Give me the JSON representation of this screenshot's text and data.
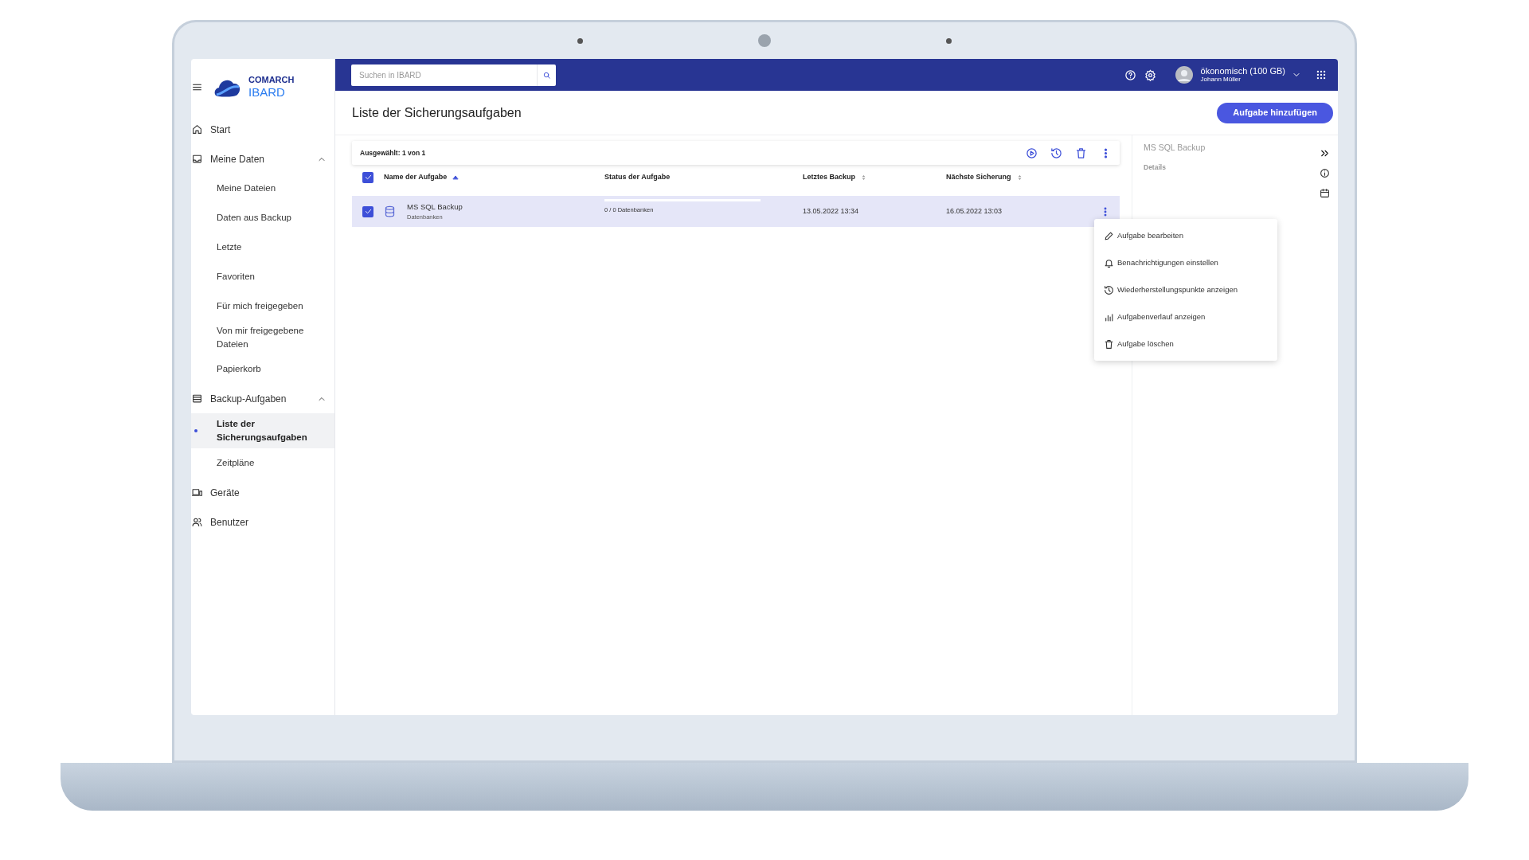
{
  "sidebar": {
    "logo": {
      "line1": "COMARCH",
      "line2": "IBARD"
    },
    "items": [
      {
        "label": "Start",
        "selected": false
      },
      {
        "label": "Meine Daten",
        "selected": false,
        "expanded": true,
        "children": [
          {
            "label": "Meine Dateien",
            "selected": false
          },
          {
            "label": "Daten aus Backup",
            "selected": false
          },
          {
            "label": "Letzte",
            "selected": false
          },
          {
            "label": "Favoriten",
            "selected": false
          },
          {
            "label": "Für mich freigegeben",
            "selected": false
          },
          {
            "label": "Von mir freigegebene Dateien",
            "selected": false
          },
          {
            "label": "Papierkorb",
            "selected": false
          }
        ]
      },
      {
        "label": "Backup-Aufgaben",
        "selected": false,
        "expanded": true,
        "children": [
          {
            "label": "Liste der Sicherungsaufgaben",
            "selected": true
          },
          {
            "label": "Zeitpläne",
            "selected": false
          }
        ]
      },
      {
        "label": "Geräte",
        "selected": false
      },
      {
        "label": "Benutzer",
        "selected": false
      }
    ]
  },
  "top_bar": {
    "search": {
      "placeholder": "Suchen in IBARD"
    },
    "account": {
      "plan": "ökonomisch (100 GB)",
      "user": "Johann Müller"
    }
  },
  "page": {
    "title": "Liste der Sicherungsaufgaben",
    "add_button": "Aufgabe hinzufügen"
  },
  "toolbar": {
    "selection": "Ausgewählt: 1 von 1"
  },
  "table": {
    "all_checked": true,
    "columns": [
      {
        "label": "Name der Aufgabe",
        "sortable": true,
        "sorted": true
      },
      {
        "label": "Status der Aufgabe",
        "sortable": false
      },
      {
        "label": "Letztes Backup",
        "sortable": true,
        "sorted": false
      },
      {
        "label": "Nächste Sicherung",
        "sortable": true,
        "sorted": false
      }
    ],
    "rows": [
      {
        "name": "MS SQL Backup",
        "type": "Datenbanken",
        "status": "0 / 0 Datenbanken",
        "last_backup": "13.05.2022 13:34",
        "next_backup": "16.05.2022 13:03",
        "checked": true,
        "selected": true
      }
    ]
  },
  "context_menu": [
    "Aufgabe bearbeiten",
    "Benachrichtigungen einstellen",
    "Wiederherstellungspunkte anzeigen",
    "Aufgabenverlauf anzeigen",
    "Aufgabe löschen"
  ],
  "details_panel": {
    "title": "MS SQL Backup",
    "tab": "Details"
  }
}
